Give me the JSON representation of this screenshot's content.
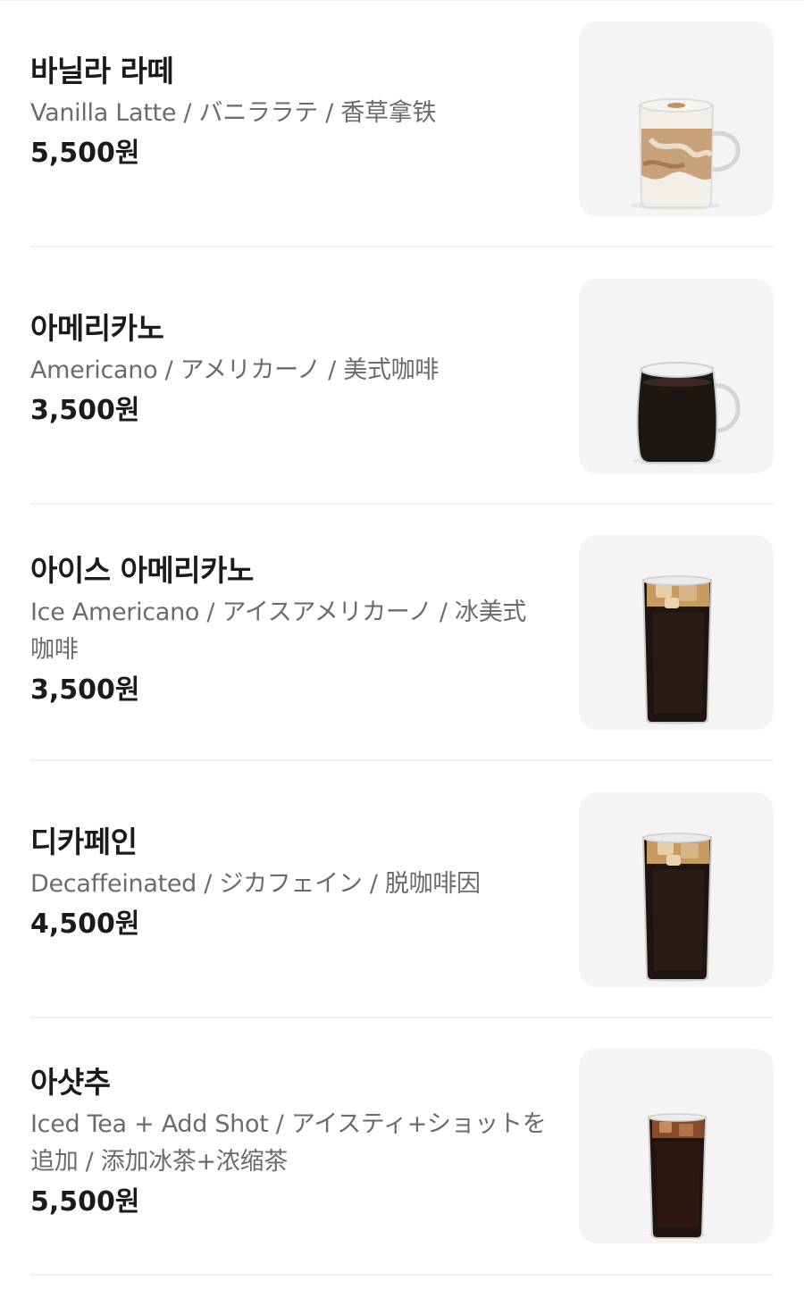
{
  "currency_suffix": "원",
  "menu": [
    {
      "name": "바닐라 라떼",
      "description": "Vanilla Latte / バニララテ / 香草拿铁",
      "price": "5,500원",
      "image": "vanilla-latte-mug"
    },
    {
      "name": "아메리카노",
      "description": "Americano / アメリカーノ / 美式咖啡",
      "price": "3,500원",
      "image": "hot-americano-mug"
    },
    {
      "name": "아이스 아메리카노",
      "description": "Ice Americano / アイスアメリカーノ / 冰美式咖啡",
      "price": "3,500원",
      "image": "iced-americano-glass"
    },
    {
      "name": "디카페인",
      "description": "Decaffeinated / ジカフェイン / 脱咖啡因",
      "price": "4,500원",
      "image": "iced-decaf-glass"
    },
    {
      "name": "아샷추",
      "description": "Iced Tea + Add Shot / アイスティ+ショットを追加 / 添加冰茶+浓缩茶",
      "price": "5,500원",
      "image": "iced-tea-shot-glass"
    }
  ]
}
